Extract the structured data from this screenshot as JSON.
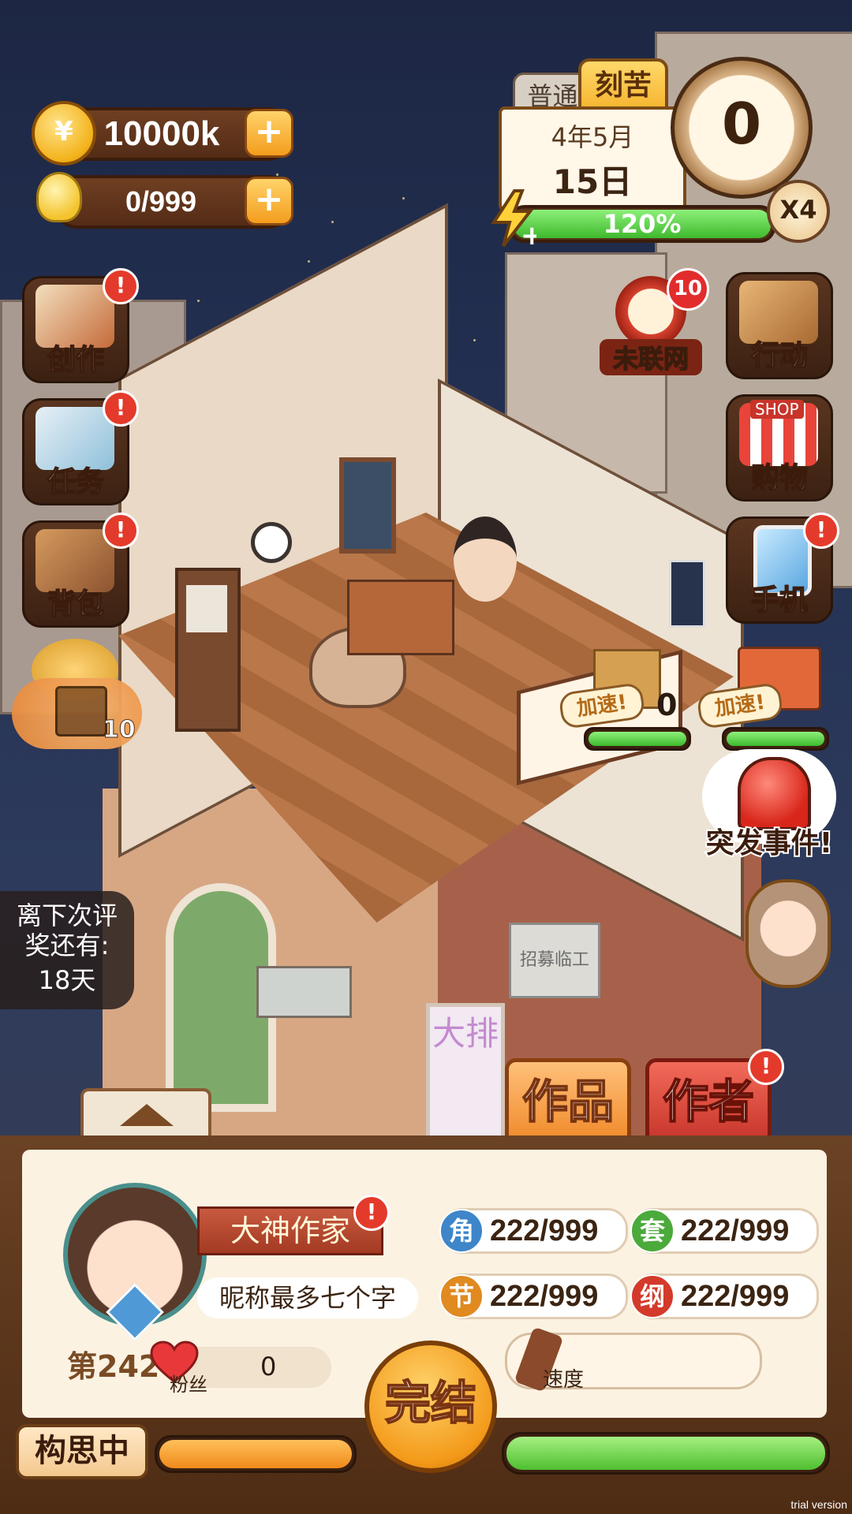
{
  "currency": {
    "coins": "10000k",
    "ideas": "0/999"
  },
  "date_panel": {
    "mode_tabs": [
      "普通",
      "刻苦"
    ],
    "active_mode": "刻苦",
    "month": "4年5月",
    "day": "15日",
    "energy_label": "120%",
    "energy_fraction": 1.0,
    "dial_value": "0",
    "speed_multiplier": "X4"
  },
  "left_menu": [
    {
      "label": "创作",
      "alert": "!"
    },
    {
      "label": "任务",
      "alert": "!"
    },
    {
      "label": "背包",
      "alert": "!"
    }
  ],
  "chest": {
    "count": "10"
  },
  "right_menu": {
    "network": {
      "label": "未联网",
      "badge": "10"
    },
    "action": {
      "label": "行动"
    },
    "shop": {
      "label": "购物",
      "sign": "SHOP"
    },
    "phone": {
      "label": "手机",
      "alert": "!"
    }
  },
  "speedups": [
    {
      "label": "加速!",
      "count": "0"
    },
    {
      "label": "加速!",
      "count": ""
    }
  ],
  "event": {
    "label": "突发事件!"
  },
  "evaluation": {
    "line1": "离下次评",
    "line2": "奖还有:",
    "days": "18天"
  },
  "scene_signs": {
    "recruit": "招募临工",
    "poster": "大排"
  },
  "bottom_tabs": {
    "works": "作品",
    "author": "作者",
    "author_alert": "!"
  },
  "profile": {
    "rank_title": "大神作家",
    "rank_alert": "!",
    "nickname": "昵称最多七个字",
    "rank_prefix": "第242",
    "fans_label": "粉丝",
    "fans_value": "0",
    "stats": [
      {
        "icon": "角",
        "value": "222/999",
        "color": "#3e86c9"
      },
      {
        "icon": "套",
        "value": "222/999",
        "color": "#4aaa3a"
      },
      {
        "icon": "节",
        "value": "222/999",
        "color": "#e08a20"
      },
      {
        "icon": "纲",
        "value": "222/999",
        "color": "#d33a2a"
      }
    ],
    "speed_label": "速度"
  },
  "bottom_bar": {
    "status": "构思中",
    "finish": "完结",
    "orange_progress": 1.0,
    "green_progress": 1.0
  },
  "watermark": "trial version"
}
